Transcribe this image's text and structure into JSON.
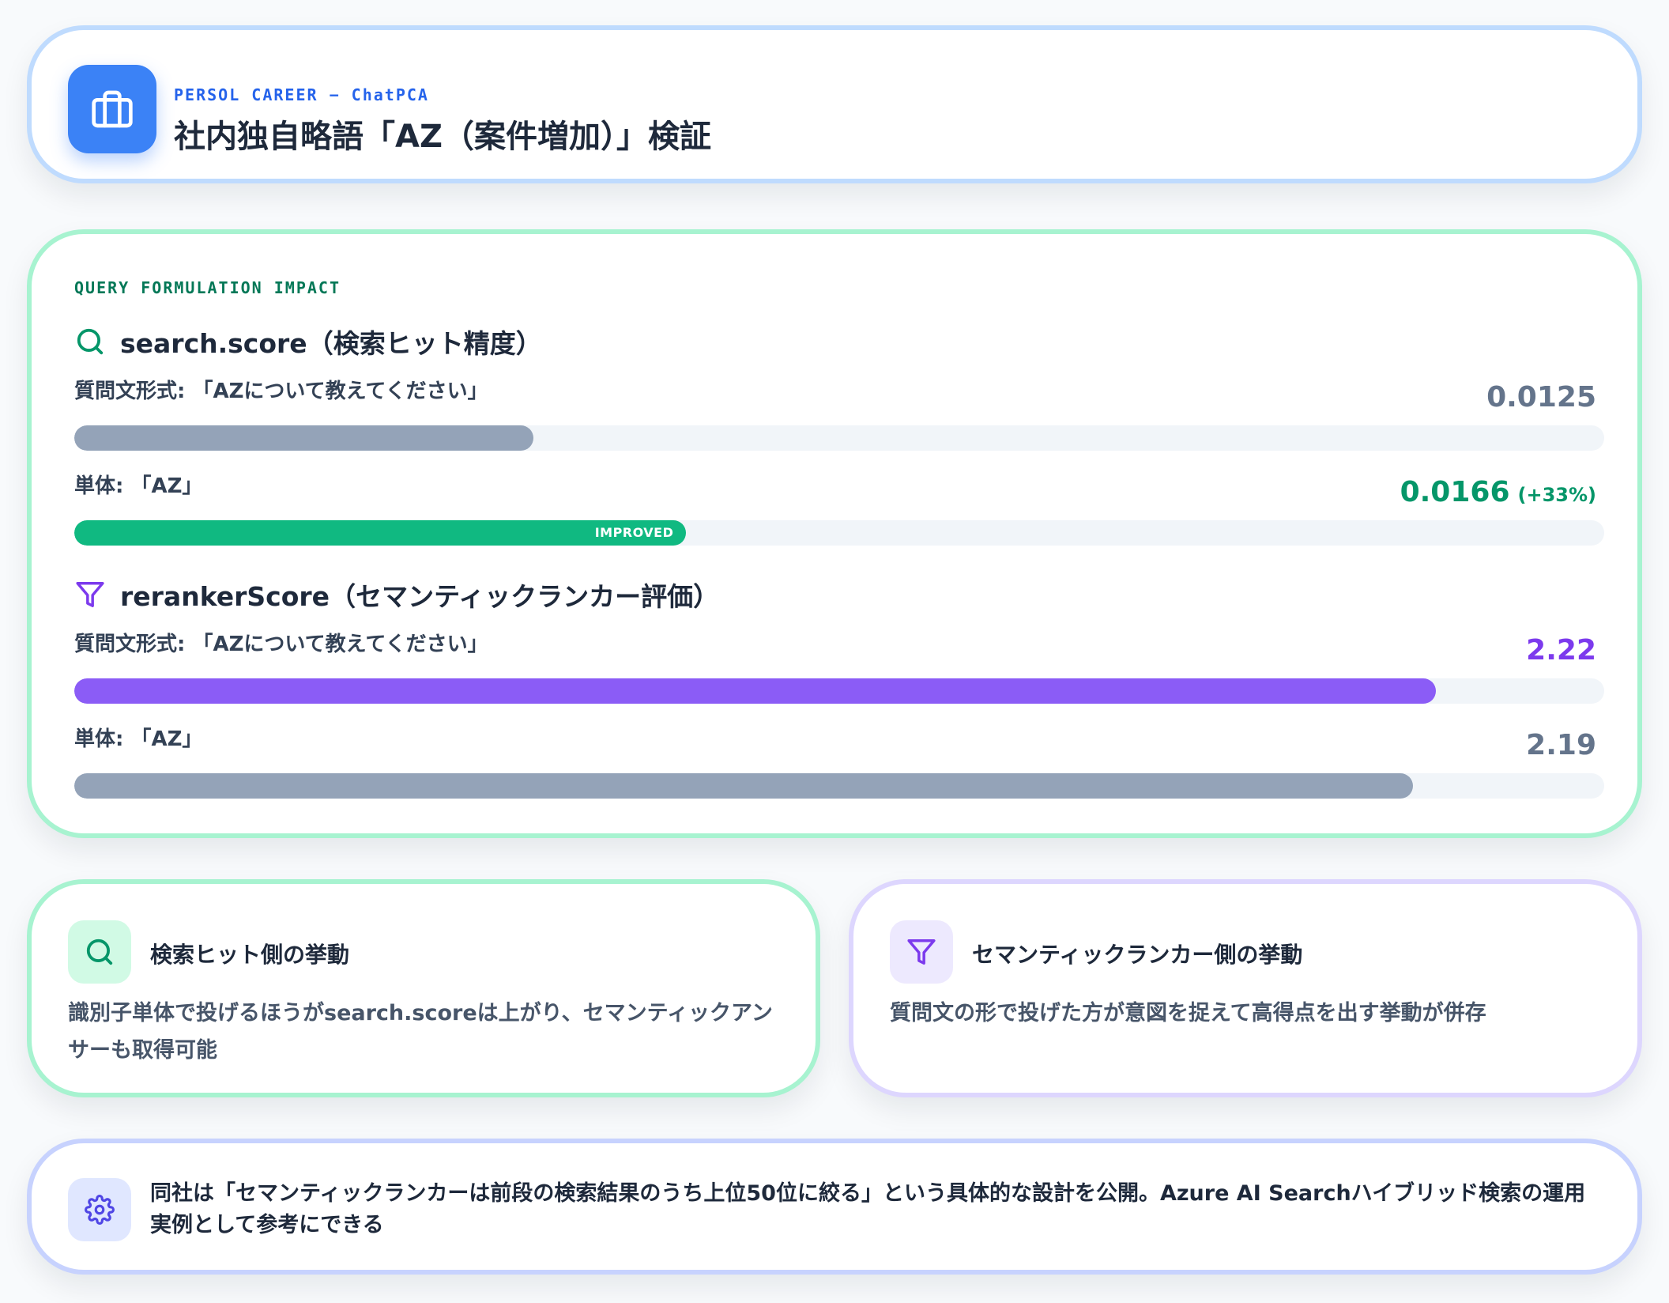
{
  "header": {
    "eyebrow": "PERSOL CAREER − ChatPCA",
    "title": "社内独自略語「AZ（案件増加）」検証",
    "logo_icon": "briefcase-icon",
    "accent": "#3b82f6"
  },
  "impact": {
    "eyebrow": "QUERY FORMULATION IMPACT",
    "search_score": {
      "title": "search.score（検索ヒット精度）",
      "icon": "search-icon",
      "question_row": {
        "label": "質問文形式: 「AZについて教えてください」",
        "value_text": "0.0125",
        "value": 0.0125,
        "fill_fraction": 0.3,
        "color": "#94a3b8"
      },
      "single_row": {
        "label": "単体: 「AZ」",
        "value_text": "0.0166",
        "delta": "(+33%)",
        "value": 0.0166,
        "fill_fraction": 0.4,
        "tag": "IMPROVED",
        "color": "#10b981"
      }
    },
    "reranker_score": {
      "title": "rerankerScore（セマンティックランカー評価）",
      "icon": "filter-icon",
      "question_row": {
        "label": "質問文形式: 「AZについて教えてください」",
        "value_text": "2.22",
        "value": 2.22,
        "fill_fraction": 0.89,
        "color": "#8b5cf6"
      },
      "single_row": {
        "label": "単体: 「AZ」",
        "value_text": "2.19",
        "value": 2.19,
        "fill_fraction": 0.875,
        "color": "#94a3b8"
      }
    }
  },
  "insights": {
    "search": {
      "icon": "search-icon",
      "title": "検索ヒット側の挙動",
      "body": "識別子単体で投げるほうがsearch.scoreは上がり、セマンティックアンサーも取得可能"
    },
    "semantic": {
      "icon": "filter-icon",
      "title": "セマンティックランカー側の挙動",
      "body": "質問文の形で投げた方が意図を捉えて高得点を出す挙動が併存"
    }
  },
  "note": {
    "icon": "gear-icon",
    "text": "同社は「セマンティックランカーは前段の検索結果のうち上位50位に絞る」という具体的な設計を公開。Azure AI Searchハイブリッド検索の運用実例として参考にできる"
  }
}
